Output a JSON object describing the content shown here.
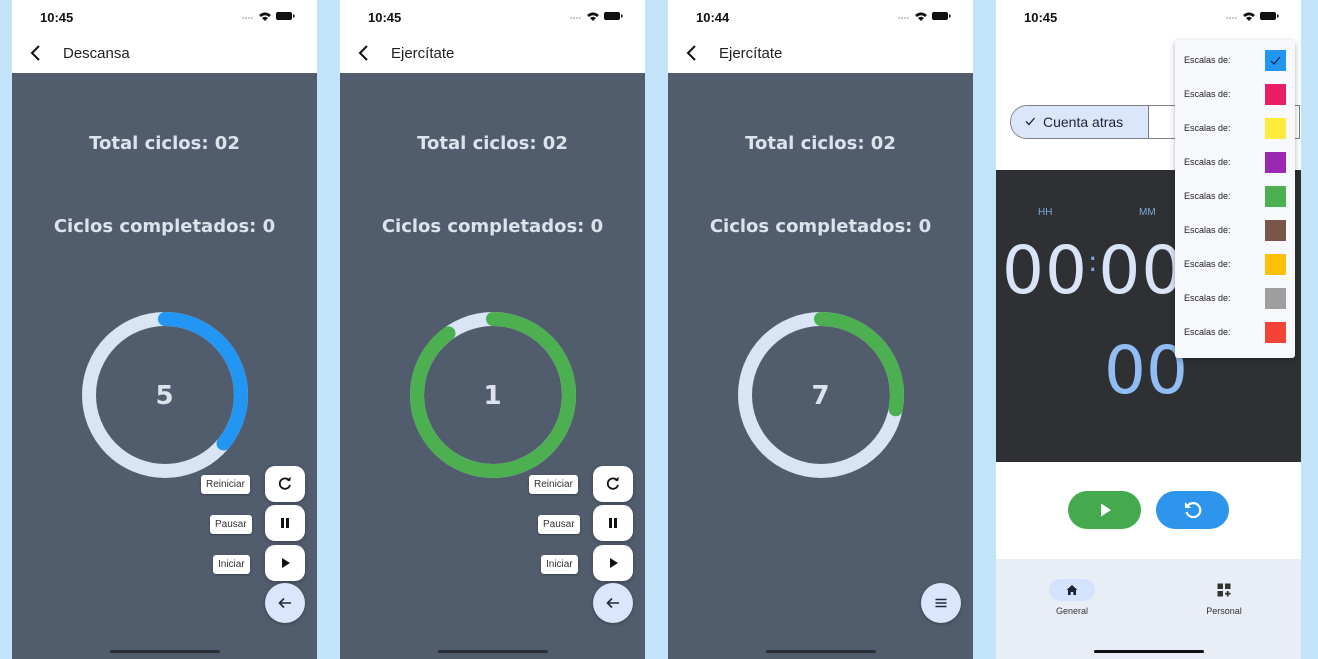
{
  "screens": [
    {
      "time": "10:45",
      "title": "Descansa",
      "total": "Total ciclos: 02",
      "completed": "Ciclos completados: 0",
      "counter": "5",
      "ring_color": "#2196f3",
      "ring_progress": 0.36,
      "fab_labels": [
        "Reiniciar",
        "Pausar",
        "Iniciar"
      ]
    },
    {
      "time": "10:45",
      "title": "Ejercítate",
      "total": "Total ciclos: 02",
      "completed": "Ciclos completados: 0",
      "counter": "1",
      "ring_color": "#4caf50",
      "ring_progress": 0.9,
      "fab_labels": [
        "Reiniciar",
        "Pausar",
        "Iniciar"
      ]
    },
    {
      "time": "10:44",
      "title": "Ejercítate",
      "total": "Total ciclos: 02",
      "completed": "Ciclos completados: 0",
      "counter": "7",
      "ring_color": "#4caf50",
      "ring_progress": 0.28
    },
    {
      "time": "10:45",
      "mode_label": "Cuenta atras",
      "unit_hh": "HH",
      "unit_mm": "MM",
      "hours": "00",
      "minutes": "00",
      "seconds": "00",
      "nav": [
        "General",
        "Personal"
      ],
      "menu_label": "Escalas de:",
      "menu_colors": [
        "#2196f3",
        "#e91e63",
        "#ffeb3b",
        "#9c27b0",
        "#4caf50",
        "#795548",
        "#ffc107",
        "#9e9e9e",
        "#f44336"
      ],
      "menu_selected": 0
    }
  ],
  "colors": {
    "surface": "#515c6d",
    "ring_track": "#d9e4f5",
    "fab_round": "#d9e6fb"
  },
  "icons": {
    "back": "chevron-left-icon",
    "reiniciar": "refresh-icon",
    "pausar": "pause-icon",
    "iniciar": "play-icon",
    "toggle": "arrow-left-icon",
    "menu": "menu-icon",
    "nav_general": "home-icon",
    "nav_personal": "dashboard-add-icon"
  }
}
